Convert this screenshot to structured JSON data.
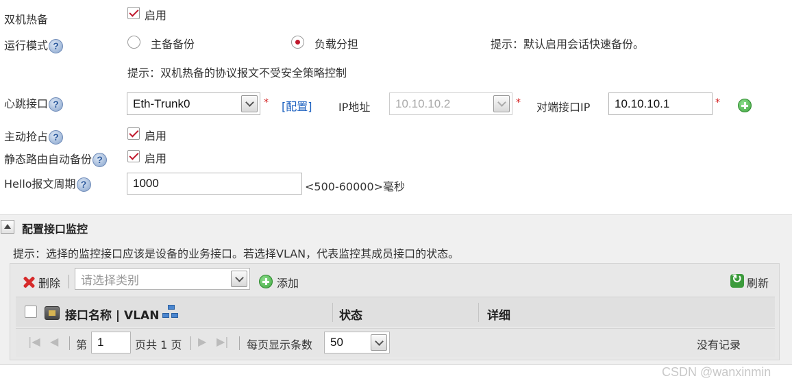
{
  "form": {
    "ha": {
      "label": "双机热备",
      "checkbox_label": "启用",
      "checked": true
    },
    "run_mode": {
      "label": "运行模式",
      "options": [
        {
          "label": "主备备份",
          "selected": false
        },
        {
          "label": "负载分担",
          "selected": true
        }
      ],
      "hint_right": "提示：默认启用会话快速备份。",
      "hint_below": "提示：双机热备的协议报文不受安全策略控制"
    },
    "heartbeat": {
      "label": "心跳接口",
      "interface_value": "Eth-Trunk0",
      "required_mark": "*",
      "config_link": "[配置]",
      "ip_label": "IP地址",
      "ip_value": "10.10.10.2",
      "peer_ip_label": "对端接口IP",
      "peer_ip_value": "10.10.10.1"
    },
    "preempt": {
      "label": "主动抢占",
      "checkbox_label": "启用",
      "checked": true
    },
    "static_route_backup": {
      "label": "静态路由自动备份",
      "checkbox_label": "启用",
      "checked": true
    },
    "hello": {
      "label": "Hello报文周期",
      "value": "1000",
      "range_hint": "<500-60000>毫秒"
    }
  },
  "monitor": {
    "title": "配置接口监控",
    "hint": "提示：选择的监控接口应该是设备的业务接口。若选择VLAN，代表监控其成员接口的状态。",
    "toolbar": {
      "delete_label": "删除",
      "category_placeholder": "请选择类别",
      "add_label": "添加",
      "refresh_label": "刷新"
    },
    "table": {
      "columns": [
        "接口名称 | VLAN",
        "状态",
        "详细"
      ]
    },
    "pager": {
      "page_prefix": "第",
      "page_value": "1",
      "page_suffix": "页共 1 页",
      "per_page_label": "每页显示条数",
      "per_page_value": "50",
      "empty_text": "没有记录"
    }
  },
  "watermark": "CSDN @wanxinmin",
  "colors": {
    "accent_red": "#c0182c",
    "link_blue": "#1a5fbf",
    "add_green": "#3ea43e"
  }
}
